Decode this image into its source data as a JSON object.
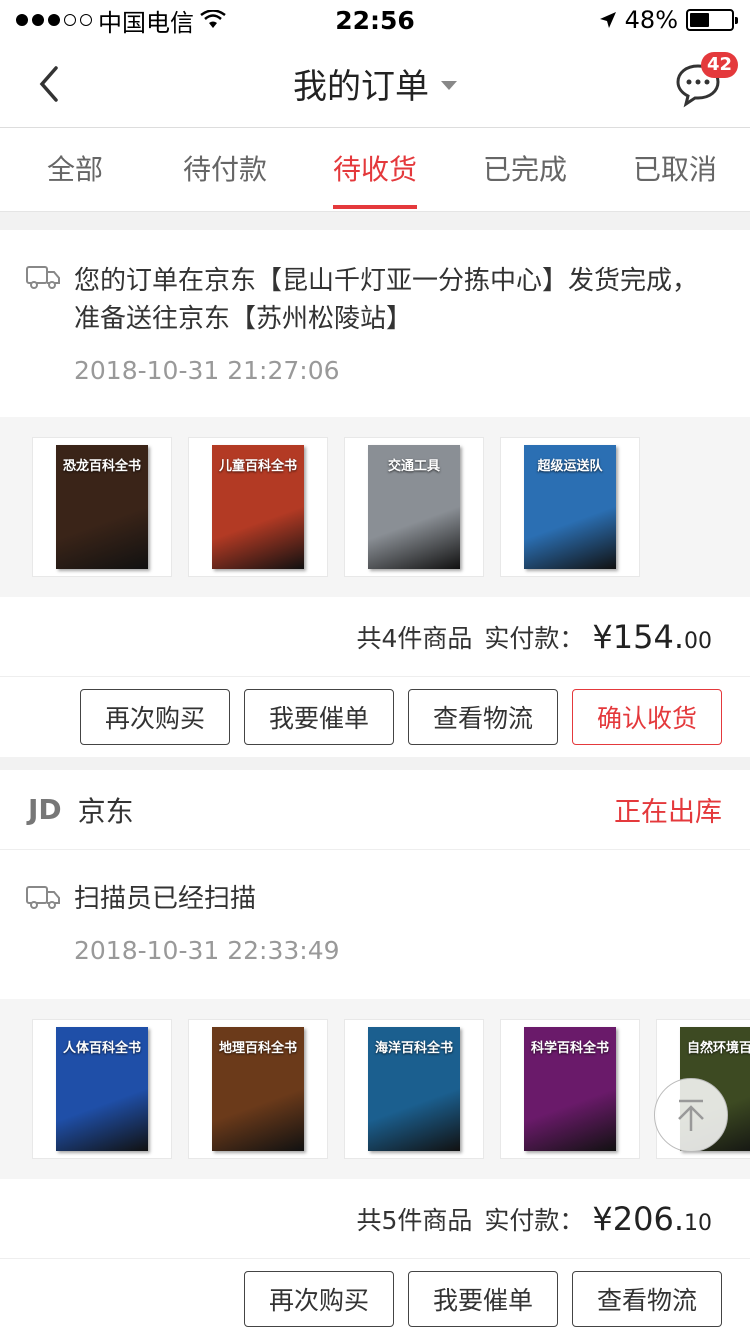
{
  "status_bar": {
    "carrier": "中国电信",
    "time": "22:56",
    "battery": "48%",
    "battery_level": 0.48
  },
  "header": {
    "title": "我的订单",
    "message_badge": "42"
  },
  "tabs": [
    {
      "label": "全部",
      "active": false
    },
    {
      "label": "待付款",
      "active": false
    },
    {
      "label": "待收货",
      "active": true
    },
    {
      "label": "已完成",
      "active": false
    },
    {
      "label": "已取消",
      "active": false
    }
  ],
  "orders": [
    {
      "tracking_text": "您的订单在京东【昆山千灯亚一分拣中心】发货完成，准备送往京东【苏州松陵站】",
      "tracking_time": "2018-10-31 21:27:06",
      "products": [
        {
          "cover_title": "恐龙百科全书",
          "color": "#3a2418"
        },
        {
          "cover_title": "儿童百科全书",
          "color": "#b33a24"
        },
        {
          "cover_title": "交通工具",
          "color": "#8a8f95"
        },
        {
          "cover_title": "超级运送队",
          "color": "#2b6fb3"
        }
      ],
      "summary_count": "共4件商品",
      "summary_paid_label": "实付款：",
      "price_main": "¥154.",
      "price_cents": "00",
      "buttons": [
        "再次购买",
        "我要催单",
        "查看物流",
        "确认收货"
      ]
    },
    {
      "shop_logo": "JD",
      "shop_name": "京东",
      "status": "正在出库",
      "tracking_text": "扫描员已经扫描",
      "tracking_time": "2018-10-31 22:33:49",
      "products": [
        {
          "cover_title": "人体百科全书",
          "color": "#1f4fa8"
        },
        {
          "cover_title": "地理百科全书",
          "color": "#6b3a1a"
        },
        {
          "cover_title": "海洋百科全书",
          "color": "#1b5f8f"
        },
        {
          "cover_title": "科学百科全书",
          "color": "#6a1a6a"
        },
        {
          "cover_title": "自然环境百科",
          "color": "#3d4a22"
        }
      ],
      "summary_count": "共5件商品",
      "summary_paid_label": "实付款：",
      "price_main": "¥206.",
      "price_cents": "10",
      "buttons": [
        "再次购买",
        "我要催单",
        "查看物流"
      ]
    }
  ]
}
